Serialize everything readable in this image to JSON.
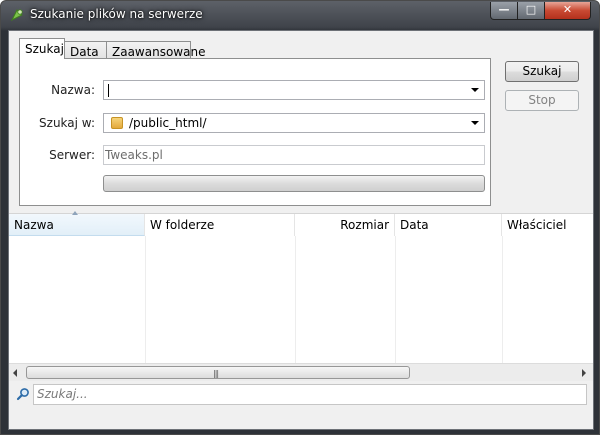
{
  "window": {
    "title": "Szukanie plików na serwerze"
  },
  "window_controls": {
    "minimize": "—",
    "maximize": "□",
    "close": "✕"
  },
  "tabs": [
    {
      "label": "Szukaj",
      "active": true
    },
    {
      "label": "Data",
      "active": false
    },
    {
      "label": "Zaawansowane",
      "active": false
    }
  ],
  "form": {
    "name_label": "Nazwa:",
    "name_value": "",
    "search_in_label": "Szukaj w:",
    "search_in_value": "/public_html/",
    "server_label": "Serwer:",
    "server_value": "Tweaks.pl",
    "progress": 0
  },
  "buttons": {
    "search": "Szukaj",
    "stop": "Stop"
  },
  "results": {
    "columns": [
      "Nazwa",
      "W folderze",
      "Rozmiar",
      "Data",
      "Właściciel"
    ],
    "sorted_column": "Nazwa",
    "rows": []
  },
  "scrollbar": {
    "grip": "|||"
  },
  "filter": {
    "placeholder": "Szukaj..."
  },
  "icons": {
    "app": "green-leaf-icon",
    "folder": "folder-icon",
    "search": "magnifier-icon"
  }
}
